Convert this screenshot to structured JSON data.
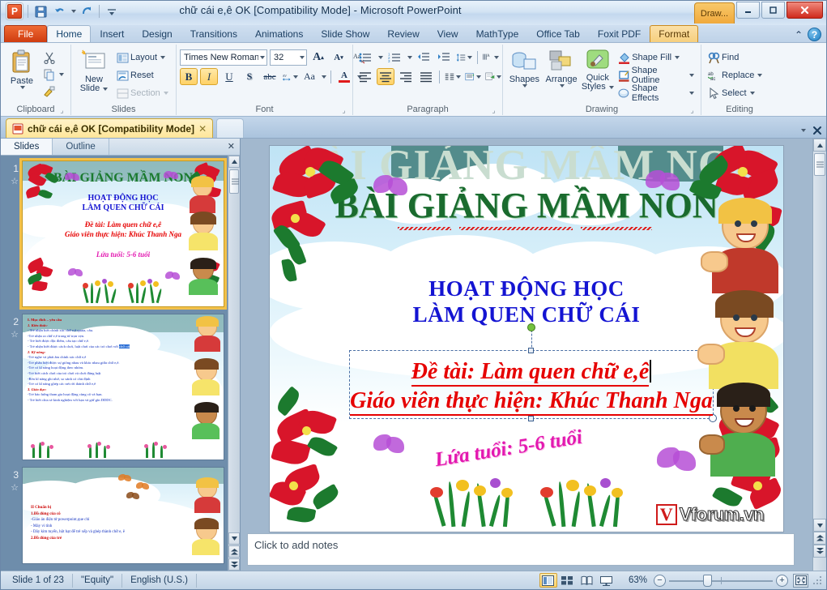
{
  "window": {
    "title": "chữ cái e,ê OK [Compatibility Mode]  -  Microsoft PowerPoint",
    "app_logo": "P",
    "contextual_tab_group": "Draw...",
    "minimize": "—",
    "maximize": "❐",
    "close": "✕",
    "help": "?",
    "collapse_ribbon": "⌃"
  },
  "quick_access": {
    "save": "save-icon",
    "undo": "undo-icon",
    "redo": "redo-icon",
    "customize": "customize-qat-icon"
  },
  "ribbon": {
    "tabs": [
      {
        "label": "File",
        "type": "file"
      },
      {
        "label": "Home",
        "type": "active"
      },
      {
        "label": "Insert",
        "type": "normal"
      },
      {
        "label": "Design",
        "type": "normal"
      },
      {
        "label": "Transitions",
        "type": "normal"
      },
      {
        "label": "Animations",
        "type": "normal"
      },
      {
        "label": "Slide Show",
        "type": "normal"
      },
      {
        "label": "Review",
        "type": "normal"
      },
      {
        "label": "View",
        "type": "normal"
      },
      {
        "label": "MathType",
        "type": "normal"
      },
      {
        "label": "Office Tab",
        "type": "normal"
      },
      {
        "label": "Foxit PDF",
        "type": "normal"
      },
      {
        "label": "Format",
        "type": "contextual"
      }
    ],
    "groups": {
      "clipboard": {
        "name": "Clipboard",
        "paste": "Paste",
        "cut": "cut-icon",
        "copy": "copy-icon",
        "format_painter": "format-painter-icon"
      },
      "slides": {
        "name": "Slides",
        "new_slide": "New\nSlide",
        "new_slide_line1": "New",
        "new_slide_line2": "Slide",
        "layout": "Layout",
        "reset": "Reset",
        "section": "Section"
      },
      "font": {
        "name": "Font",
        "font_family": "Times New Roman",
        "font_size": "32",
        "grow_font": "A",
        "shrink_font": "A",
        "clear_formatting": "clear-formatting-icon",
        "bold": "B",
        "italic": "I",
        "underline": "U",
        "shadow": "S",
        "strikethrough": "abc",
        "char_spacing": "AV",
        "change_case": "Aa",
        "font_color": "A"
      },
      "paragraph": {
        "name": "Paragraph",
        "bullets": "bullets-icon",
        "numbering": "numbering-icon",
        "decrease_indent": "decrease-indent-icon",
        "increase_indent": "increase-indent-icon",
        "line_spacing": "line-spacing-icon",
        "align_left": "align-left-icon",
        "align_center": "align-center-icon",
        "align_right": "align-right-icon",
        "justify": "justify-icon",
        "columns": "columns-icon",
        "text_direction": "text-direction-icon",
        "align_text": "align-text-icon",
        "convert_smartart": "convert-to-smartart-icon"
      },
      "drawing": {
        "name": "Drawing",
        "shapes": "Shapes",
        "arrange": "Arrange",
        "quick_styles_line1": "Quick",
        "quick_styles_line2": "Styles",
        "shape_fill": "Shape Fill",
        "shape_outline": "Shape Outline",
        "shape_effects": "Shape Effects"
      },
      "editing": {
        "name": "Editing",
        "find": "Find",
        "replace": "Replace",
        "select": "Select"
      }
    }
  },
  "document_tab": {
    "label": "chữ cái e,ê OK [Compatibility Mode]",
    "close": "✕"
  },
  "left_pane": {
    "tab_slides": "Slides",
    "tab_outline": "Outline",
    "close": "✕"
  },
  "slides": [
    {
      "number": "1",
      "selected": true,
      "type": "title",
      "title": "BÀI GIẢNG MẦM NON",
      "sub_line1": "HOẠT ĐỘNG HỌC",
      "sub_line2": "LÀM QUEN CHỮ CÁI",
      "topic_line1": "Đề tài: Làm quen chữ e,ê",
      "topic_line2": "Giáo viên thực hiện: Khúc Thanh Nga",
      "age_label": "Lứa tuổi: 5-6 tuổi"
    },
    {
      "number": "2",
      "selected": false,
      "type": "bullets",
      "lines": [
        {
          "text": "I. Mục đích – yêu cầu",
          "style": "hd"
        },
        {
          "text": " 1. Kiến thức:",
          "style": "hdi"
        },
        {
          "text": "- Trẻ nhận biết chính xác chữ  e,ê quata, câu.",
          "style": "b"
        },
        {
          "text": "-Trẻ nhận ra chữ  e,ê trong từ trọn vẹn.",
          "style": "b"
        },
        {
          "text": "-  Trẻ  biết được đặc điểm, cấu tạo chữ  e,ê.",
          "style": "b"
        },
        {
          "text": "- Trẻ nhận biết được cách chơi, luật chơi của các trò chơi với chữ cái",
          "style": "b-hl"
        },
        {
          "text": " 2. Kỹ năng:",
          "style": "hdi"
        },
        {
          "text": "-Trẻ nghe và phát âm chính xác chữ  e,ê",
          "style": "b"
        },
        {
          "text": "-Trẻ phân biệt được sự giống nhau và khác nhau giữa chữ  e,ê.",
          "style": "b"
        },
        {
          "text": "-Trẻ có kĩ năng hoạt động theo nhóm.",
          "style": "b"
        },
        {
          "text": "-Trẻ biết cách chơi của trò chơi và chơi đúng luật",
          "style": "b"
        },
        {
          "text": "-Rèn kĩ năng ghi nhớ, so sánh có chủ định",
          "style": "b"
        },
        {
          "text": "-Trẻ có kĩ năng ghép các nét rời thành chữ  e,ê",
          "style": "b"
        },
        {
          "text": " 3. Giáo dục:",
          "style": "hdi"
        },
        {
          "text": "-Trẻ hào hứng tham gia hoạt động cùng cô và bạn.",
          "style": "b"
        },
        {
          "text": "-  Trẻ biết chia sẻ kinh nghiệm với bạn và giữ gìn DDDC.",
          "style": "b"
        }
      ]
    },
    {
      "number": "3",
      "selected": false,
      "type": "bullets",
      "lines": [
        {
          "text": "II Chuẩn bị",
          "style": "hd"
        },
        {
          "text": "1.Đồ dùng của cô",
          "style": "hd"
        },
        {
          "text": "-Giáo án điện tử powerpoint,que chỉ",
          "style": "b"
        },
        {
          "text": "- Máy vi tính",
          "style": "b"
        },
        {
          "text": "- Dây kim tuyến, hột hạt để trẻ xếp và ghép thành chữ e, ê",
          "style": "b"
        },
        {
          "text": "2.Đồ dùng của trẻ",
          "style": "hd"
        }
      ]
    }
  ],
  "notes": {
    "placeholder": "Click to add notes"
  },
  "status_bar": {
    "slide_count": "Slide 1 of 23",
    "theme": "\"Equity\"",
    "language": "English (U.S.)",
    "zoom": "63%",
    "views": {
      "normal": "normal-view-icon",
      "slide_sorter": "slide-sorter-view-icon",
      "reading": "reading-view-icon",
      "slide_show": "slide-show-icon"
    },
    "zoom_out": "−",
    "zoom_in": "+",
    "fit_to_window": "fit-slide-to-window-icon"
  },
  "slide_canvas": {
    "watermark_brand": "Vforum.vn",
    "watermark_mark": "V"
  },
  "colors": {
    "title_green": "#1a6b2e",
    "subtitle_blue": "#1414d2",
    "topic_red": "#e60000",
    "age_magenta": "#e318b0",
    "ribbon_bg": "#f2f6fa",
    "file_tab": "#cf3c10",
    "selection_dash": "#4a6fa5"
  }
}
